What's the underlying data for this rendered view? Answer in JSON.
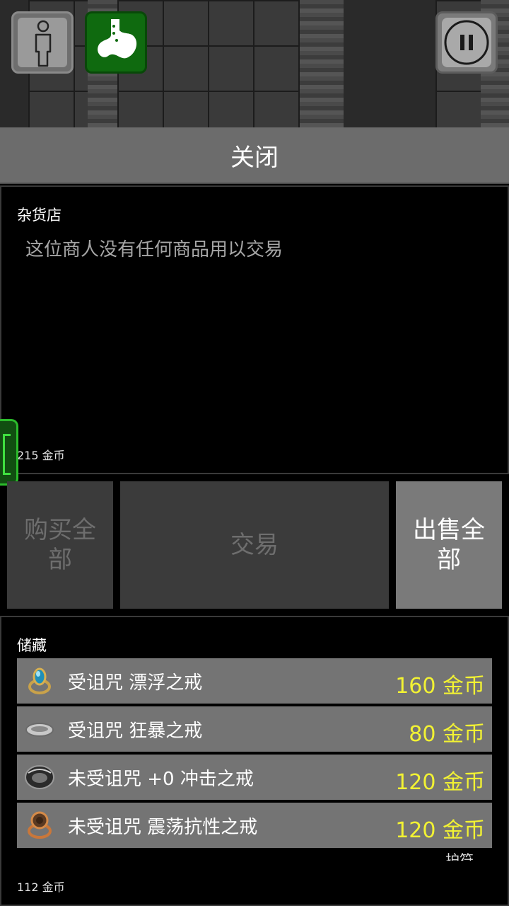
{
  "close_bar": {
    "label": "关闭"
  },
  "shop": {
    "title": "杂货店",
    "empty_message": "这位商人没有任何商品用以交易",
    "gold": "215 金币"
  },
  "actions": {
    "buy_all": "购买全部",
    "trade": "交易",
    "sell_all": "出售全部"
  },
  "stash": {
    "title": "储藏",
    "items": [
      {
        "name": "受诅咒 漂浮之戒",
        "price": "160 金币",
        "icon": "sapphire-ring-icon"
      },
      {
        "name": "受诅咒 狂暴之戒",
        "price": "80 金币",
        "icon": "silver-ring-icon"
      },
      {
        "name": "未受诅咒 +0 冲击之戒",
        "price": "120 金币",
        "icon": "dark-ring-icon"
      },
      {
        "name": "未受诅咒 震荡抗性之戒",
        "price": "120 金币",
        "icon": "bronze-ring-icon"
      }
    ],
    "partial_label": "护符",
    "gold": "112 金币"
  },
  "colors": {
    "price": "#f2f233",
    "close_bar": "#6c6c6c",
    "item_row": "#747474",
    "side_tab": "#2bbb2b"
  }
}
